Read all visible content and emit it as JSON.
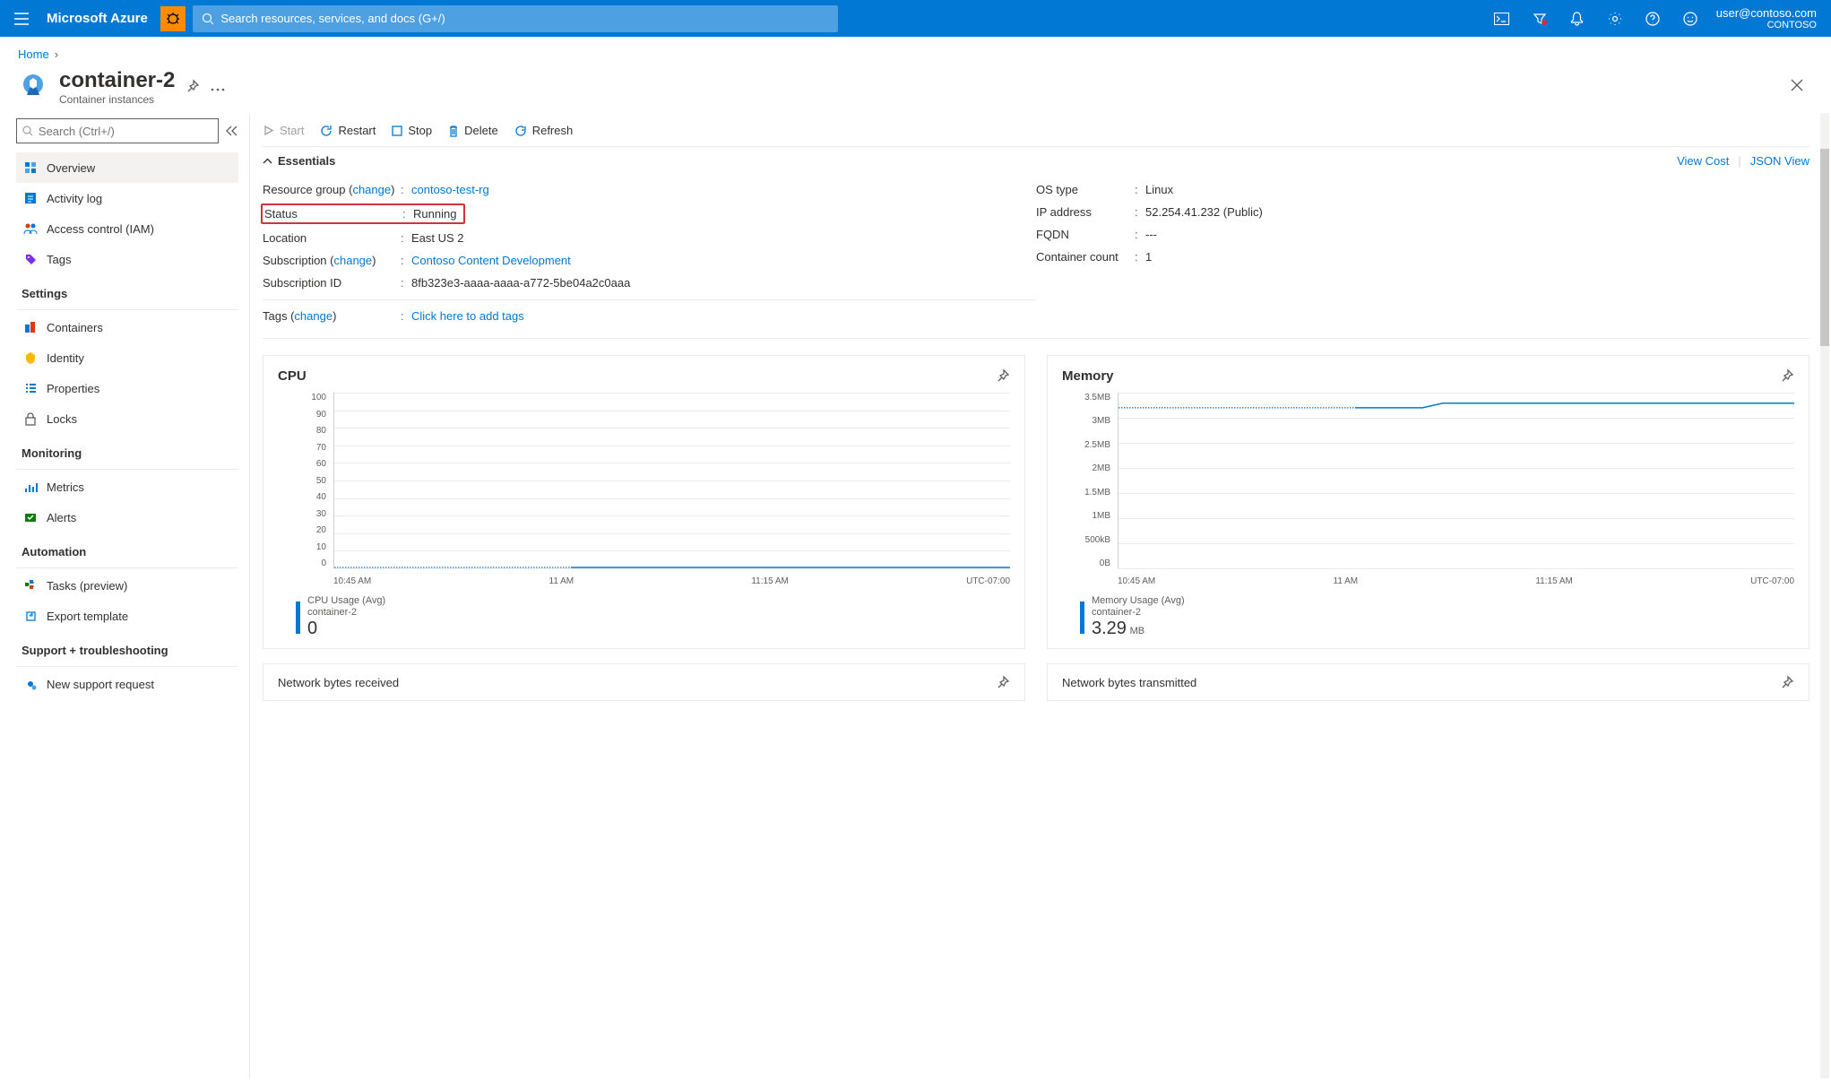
{
  "header": {
    "brand": "Microsoft Azure",
    "search_placeholder": "Search resources, services, and docs (G+/)",
    "user_email": "user@contoso.com",
    "tenant": "CONTOSO"
  },
  "breadcrumb": {
    "home": "Home"
  },
  "resource": {
    "title": "container-2",
    "subtitle": "Container instances"
  },
  "sidebar": {
    "search_placeholder": "Search (Ctrl+/)",
    "items_top": [
      {
        "label": "Overview",
        "icon": "overview"
      },
      {
        "label": "Activity log",
        "icon": "activity"
      },
      {
        "label": "Access control (IAM)",
        "icon": "iam"
      },
      {
        "label": "Tags",
        "icon": "tags"
      }
    ],
    "settings_heading": "Settings",
    "items_settings": [
      {
        "label": "Containers",
        "icon": "containers"
      },
      {
        "label": "Identity",
        "icon": "identity"
      },
      {
        "label": "Properties",
        "icon": "properties"
      },
      {
        "label": "Locks",
        "icon": "locks"
      }
    ],
    "monitoring_heading": "Monitoring",
    "items_monitoring": [
      {
        "label": "Metrics",
        "icon": "metrics"
      },
      {
        "label": "Alerts",
        "icon": "alerts"
      }
    ],
    "automation_heading": "Automation",
    "items_automation": [
      {
        "label": "Tasks (preview)",
        "icon": "tasks"
      },
      {
        "label": "Export template",
        "icon": "export"
      }
    ],
    "support_heading": "Support + troubleshooting",
    "items_support": [
      {
        "label": "New support request",
        "icon": "support"
      }
    ]
  },
  "toolbar": {
    "start": "Start",
    "restart": "Restart",
    "stop": "Stop",
    "delete": "Delete",
    "refresh": "Refresh"
  },
  "essentials": {
    "toggle": "Essentials",
    "view_cost": "View Cost",
    "json_view": "JSON View",
    "left": {
      "rg_label": "Resource group (",
      "rg_change": "change",
      "rg_label_end": ")",
      "rg_value": "contoso-test-rg",
      "status_label": "Status",
      "status_value": "Running",
      "location_label": "Location",
      "location_value": "East US 2",
      "sub_label": "Subscription (",
      "sub_change": "change",
      "sub_label_end": ")",
      "sub_value": "Contoso Content Development",
      "subid_label": "Subscription ID",
      "subid_value": "8fb323e3-aaaa-aaaa-a772-5be04a2c0aaa",
      "tags_label": "Tags (",
      "tags_change": "change",
      "tags_label_end": ")",
      "tags_value": "Click here to add tags"
    },
    "right": {
      "os_label": "OS type",
      "os_value": "Linux",
      "ip_label": "IP address",
      "ip_value": "52.254.41.232 (Public)",
      "fqdn_label": "FQDN",
      "fqdn_value": "---",
      "count_label": "Container count",
      "count_value": "1"
    }
  },
  "charts": {
    "cpu": {
      "title": "CPU",
      "legend_title": "CPU Usage (Avg)",
      "legend_sub": "container-2",
      "legend_value": "0",
      "legend_unit": ""
    },
    "memory": {
      "title": "Memory",
      "legend_title": "Memory Usage (Avg)",
      "legend_sub": "container-2",
      "legend_value": "3.29",
      "legend_unit": "MB"
    },
    "net_rx": "Network bytes received",
    "net_tx": "Network bytes transmitted"
  },
  "chart_data": [
    {
      "type": "line",
      "title": "CPU",
      "ylabel": "CPU Usage (Avg)",
      "ylim": [
        0,
        100
      ],
      "y_ticks": [
        0,
        10,
        20,
        30,
        40,
        50,
        60,
        70,
        80,
        90,
        100
      ],
      "x_ticks": [
        "10:45 AM",
        "11 AM",
        "11:15 AM",
        "UTC-07:00"
      ],
      "series": [
        {
          "name": "container-2",
          "values": [
            0,
            0,
            0,
            0,
            0,
            0,
            0,
            0,
            0,
            0,
            0,
            0
          ]
        }
      ]
    },
    {
      "type": "line",
      "title": "Memory",
      "ylabel": "Memory Usage (Avg)",
      "ylim": [
        0,
        3.5
      ],
      "y_ticks": [
        "0B",
        "500kB",
        "1MB",
        "1.5MB",
        "2MB",
        "2.5MB",
        "3MB",
        "3.5MB"
      ],
      "x_ticks": [
        "10:45 AM",
        "11 AM",
        "11:15 AM",
        "UTC-07:00"
      ],
      "series": [
        {
          "name": "container-2",
          "values_mb": [
            3.2,
            3.2,
            3.2,
            3.2,
            3.2,
            3.2,
            3.29,
            3.29,
            3.29,
            3.29,
            3.29,
            3.29
          ]
        }
      ]
    }
  ]
}
